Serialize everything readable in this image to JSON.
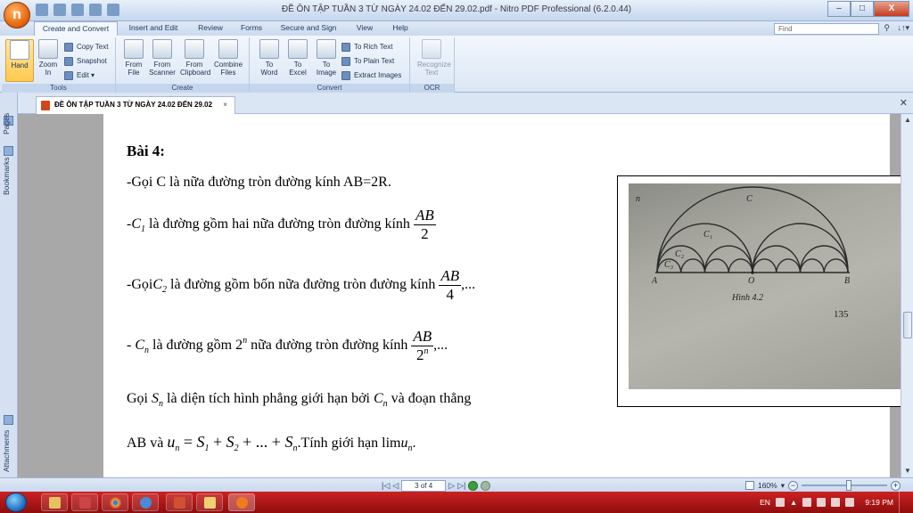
{
  "window": {
    "title": "ĐỀ ÔN TẬP TUẦN 3 TỪ NGÀY 24.02 ĐẾN 29.02.pdf - Nitro PDF Professional (6.2.0.44)",
    "min": "–",
    "max": "□",
    "close": "X"
  },
  "ribbon_tabs": [
    "Create and Convert",
    "Insert and Edit",
    "Review",
    "Forms",
    "Secure and Sign",
    "View",
    "Help"
  ],
  "find": {
    "placeholder": "Find"
  },
  "ribbon": {
    "tools": {
      "label": "Tools",
      "hand": "Hand",
      "zoom": "Zoom\nIn",
      "copy_text": "Copy Text",
      "snapshot": "Snapshot",
      "edit": "Edit"
    },
    "create": {
      "label": "Create",
      "from_file": "From\nFile",
      "from_scanner": "From\nScanner",
      "from_clipboard": "From\nClipboard",
      "combine": "Combine\nFiles"
    },
    "convert": {
      "label": "Convert",
      "to_word": "To\nWord",
      "to_excel": "To\nExcel",
      "to_image": "To\nImage",
      "to_rich_text": "To Rich Text",
      "to_plain_text": "To Plain Text",
      "extract_images": "Extract Images"
    },
    "ocr": {
      "label": "OCR",
      "recognize": "Recognize\nText"
    }
  },
  "document_tab": {
    "title": "ĐỀ ÔN TẬP TUẦN 3 TỪ NGÀY 24.02 ĐẾN 29.02",
    "close": "×"
  },
  "side_panel": {
    "pages": "Pages",
    "bookmarks": "Bookmarks",
    "attachments": "Attachments"
  },
  "page": {
    "heading": "Bài 4:",
    "line1": "-Gọi C là nữa đường tròn đường kính AB=2R.",
    "line2_pre": "-",
    "line2_var": "C",
    "line2_sub": "1",
    "line2_text": " là đường gồm hai nữa đường tròn đường kính ",
    "line2_num": "AB",
    "line2_den": "2",
    "line3_pre": "-Gọi",
    "line3_var": "C",
    "line3_sub": "2",
    "line3_text": " là đường gồm bốn  nữa đường tròn đường kính ",
    "line3_num": "AB",
    "line3_den": "4",
    "line3_tail": ",...",
    "line4_pre": "- ",
    "line4_var": "C",
    "line4_sub": "n",
    "line4_text": " là đường gồm 2",
    "line4_sup": "n",
    "line4_text2": "  nữa đường tròn đường kính ",
    "line4_num": "AB",
    "line4_den": "2",
    "line4_densup": "n",
    "line4_tail": ",...",
    "line5_pre": "Gọi ",
    "line5_var": "S",
    "line5_sub": "n",
    "line5_text": "  là diện tích hình phẳng giới hạn bởi ",
    "line5_var2": "C",
    "line5_sub2": "n",
    "line5_text2": "  và đoạn thẳng",
    "line6_pre": "AB và  ",
    "line6_formula_u": "u",
    "line6_u_sub": "n",
    "line6_eq": " = ",
    "line6_s": "S",
    "line6_plus": " + ",
    "line6_dots": "... + ",
    "line6_sub1": "1",
    "line6_sub2": "2",
    "line6_subn": "n",
    "line6_tail": ".Tính giới hạn lim",
    "line6_end": "."
  },
  "figure": {
    "label_c": "C",
    "label_c1": "C₁",
    "label_c2": "C₂",
    "label_c3": "C₃",
    "label_a": "A",
    "label_o": "O",
    "label_b": "B",
    "caption": "Hình 4.2",
    "page_number": "135",
    "edge_letter": "n"
  },
  "status": {
    "page_indicator": "3 of 4",
    "zoom": "160%",
    "first": "|◁",
    "prev": "◁",
    "next": "▷",
    "last": "▷|"
  },
  "taskbar": {
    "language": "EN",
    "time": "9:19 PM"
  }
}
